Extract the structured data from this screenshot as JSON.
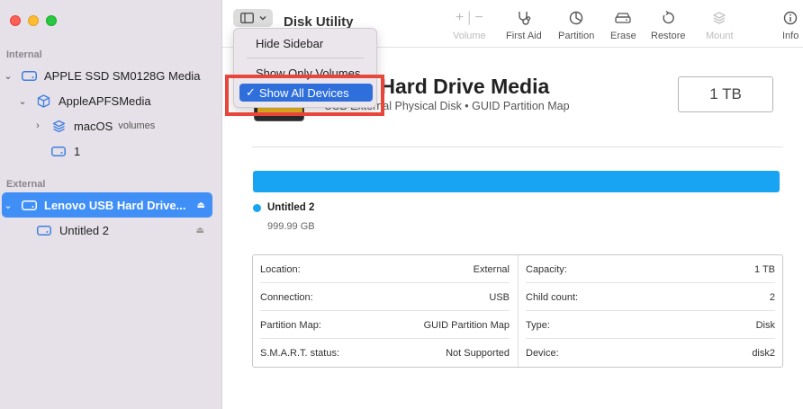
{
  "app": {
    "title": "Disk Utility"
  },
  "sidebar": {
    "sections": {
      "internal": "Internal",
      "external": "External"
    },
    "items": [
      {
        "label": "APPLE SSD SM0128G Media",
        "extra": ""
      },
      {
        "label": "AppleAPFSMedia",
        "extra": ""
      },
      {
        "label": "macOS",
        "extra": "volumes"
      },
      {
        "label": "1",
        "extra": ""
      },
      {
        "label": "Lenovo USB Hard Drive...",
        "extra": ""
      },
      {
        "label": "Untitled 2",
        "extra": ""
      }
    ]
  },
  "toolbar": {
    "volume": "Volume",
    "first_aid": "First Aid",
    "partition": "Partition",
    "erase": "Erase",
    "restore": "Restore",
    "mount": "Mount",
    "info": "Info"
  },
  "menu": {
    "hide_sidebar": "Hide Sidebar",
    "show_only_volumes": "Show Only Volumes",
    "show_all_devices": "Show All Devices",
    "check": "✓"
  },
  "disk": {
    "title": "Lenovo USB Hard Drive Media",
    "visible_title": "o USB Hard Drive Media",
    "subtitle": "USB External Physical Disk • GUID Partition Map",
    "capacity_badge": "1 TB"
  },
  "usage": {
    "partition_name": "Untitled 2",
    "partition_size": "999.99 GB",
    "color": "#18a4f3"
  },
  "info": {
    "left": [
      {
        "label": "Location:",
        "value": "External"
      },
      {
        "label": "Connection:",
        "value": "USB"
      },
      {
        "label": "Partition Map:",
        "value": "GUID Partition Map"
      },
      {
        "label": "S.M.A.R.T. status:",
        "value": "Not Supported"
      }
    ],
    "right": [
      {
        "label": "Capacity:",
        "value": "1 TB"
      },
      {
        "label": "Child count:",
        "value": "2"
      },
      {
        "label": "Type:",
        "value": "Disk"
      },
      {
        "label": "Device:",
        "value": "disk2"
      }
    ]
  },
  "colors": {
    "accent": "#3f8ff7",
    "highlight": "#e8453b",
    "menu_selected": "#2f6fdb"
  }
}
